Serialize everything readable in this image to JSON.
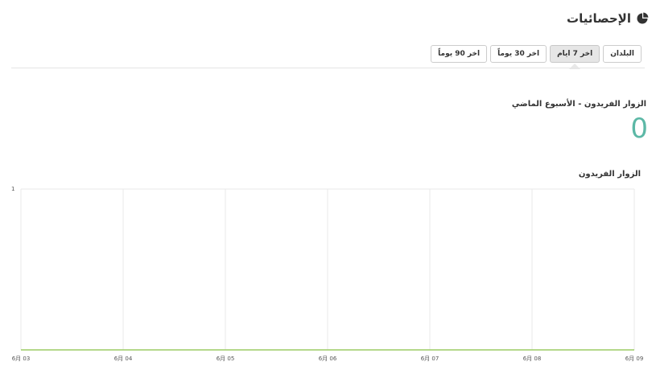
{
  "header": {
    "title": "الإحصائيات",
    "icon": "pie-chart-icon"
  },
  "tabs": [
    {
      "label": "البلدان",
      "active": false
    },
    {
      "label": "اخر 7 ايام",
      "active": true
    },
    {
      "label": "اخر 30 يوماً",
      "active": false
    },
    {
      "label": "اخر 90 يوماً",
      "active": false
    }
  ],
  "stats": {
    "unique_visitors_label": "الزوار الفريدون - الأسبوع الماضي",
    "unique_visitors_value": "0",
    "value_color": "#5cb8a6"
  },
  "chart": {
    "title": "الزوار الفريدون",
    "line_color": "#9ccc65",
    "grid_color": "#e8e8e8"
  },
  "chart_data": {
    "type": "line",
    "title": "الزوار الفريدون",
    "x": [
      "6月 03",
      "6月 04",
      "6月 05",
      "6月 06",
      "6月 07",
      "6月 08",
      "6月 09"
    ],
    "series": [
      {
        "values": [
          0,
          0,
          0,
          0,
          0,
          0,
          0
        ]
      }
    ],
    "yticks": [
      "1"
    ],
    "ylim": [
      0,
      1
    ],
    "grid": true
  }
}
